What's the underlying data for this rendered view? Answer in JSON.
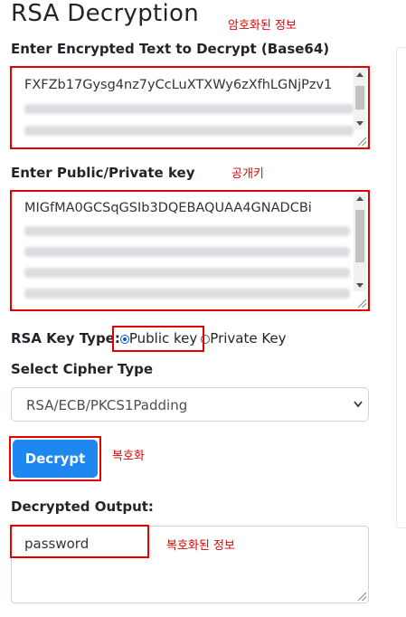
{
  "page_title": "RSA Decryption",
  "annotations": {
    "encrypted": "암호화된 정보",
    "key": "공개키",
    "decrypt": "복호화",
    "output": "복호화된 정보"
  },
  "encrypted_input": {
    "label": "Enter Encrypted Text to Decrypt (Base64)",
    "visible_value": "FXFZb17Gysg4nz7yCcLuXTXWy6zXfhLGNjPzv1"
  },
  "key_input": {
    "label": "Enter Public/Private key",
    "visible_value": "MIGfMA0GCSqGSIb3DQEBAQUAA4GNADCBi"
  },
  "key_type": {
    "label": "RSA Key Type:",
    "options": [
      "Public key",
      "Private Key"
    ],
    "selected": "Public key"
  },
  "cipher": {
    "label": "Select Cipher Type",
    "selected": "RSA/ECB/PKCS1Padding"
  },
  "decrypt_button": {
    "label": "Decrypt"
  },
  "output": {
    "label": "Decrypted Output:",
    "value": "password"
  },
  "colors": {
    "annotation": "#e60000",
    "button": "#1e88f0"
  }
}
